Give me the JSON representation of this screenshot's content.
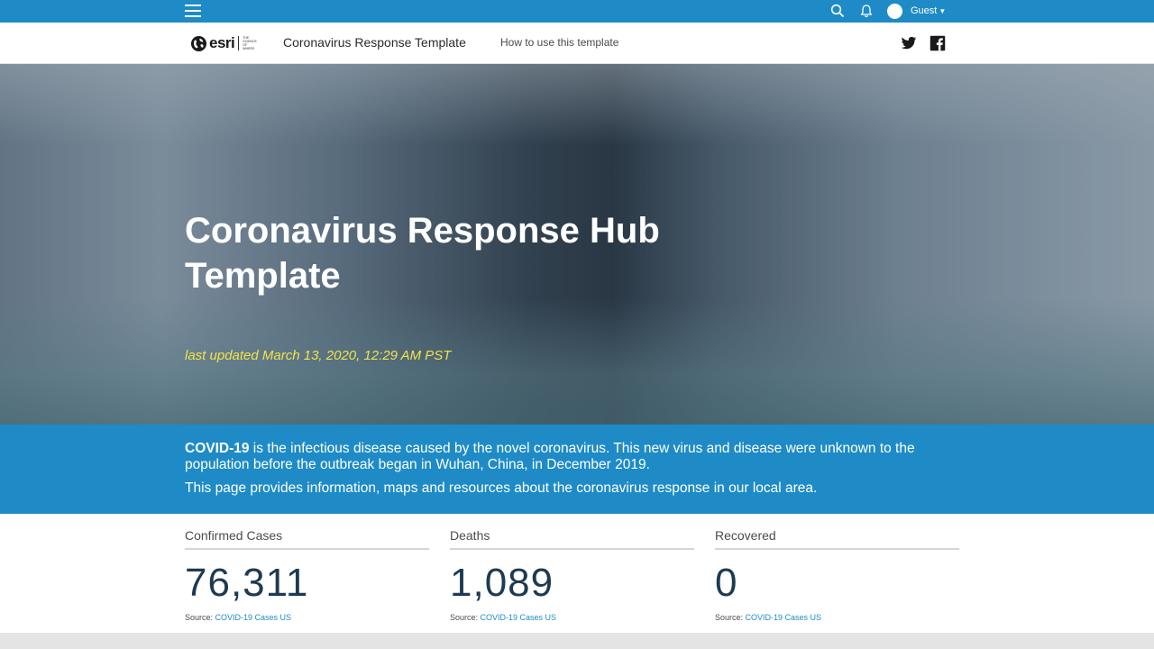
{
  "topbar": {
    "user_label": "Guest"
  },
  "header": {
    "logo_text": "esri",
    "logo_tagline": "THE SCIENCE OF WHERE",
    "site_title": "Coronavirus Response Template",
    "nav_link": "How to use this template"
  },
  "hero": {
    "title": "Coronavirus Response Hub Template",
    "last_updated": "last updated March 13, 2020, 12:29 AM PST"
  },
  "intro": {
    "term": "COVID-19",
    "description": " is the infectious disease caused by the novel coronavirus. This new virus and disease were unknown to the population before the outbreak began in Wuhan, China, in December 2019.",
    "purpose": "This page provides information, maps and resources about the coronavirus response in our local area."
  },
  "stats": [
    {
      "label": "Confirmed Cases",
      "value": "76,311",
      "source_prefix": "Source: ",
      "source_link": "COVID-19 Cases US"
    },
    {
      "label": "Deaths",
      "value": "1,089",
      "source_prefix": "Source: ",
      "source_link": "COVID-19 Cases US"
    },
    {
      "label": "Recovered",
      "value": "0",
      "source_prefix": "Source: ",
      "source_link": "COVID-19 Cases US"
    }
  ],
  "colors": {
    "brand_blue": "#1e8bc7",
    "stat_number": "#1d3a52",
    "updated_text": "#f3e34a"
  },
  "icons": [
    "menu-icon",
    "search-icon",
    "bell-icon",
    "avatar",
    "caret-down-icon",
    "globe-icon",
    "twitter-icon",
    "facebook-icon"
  ]
}
